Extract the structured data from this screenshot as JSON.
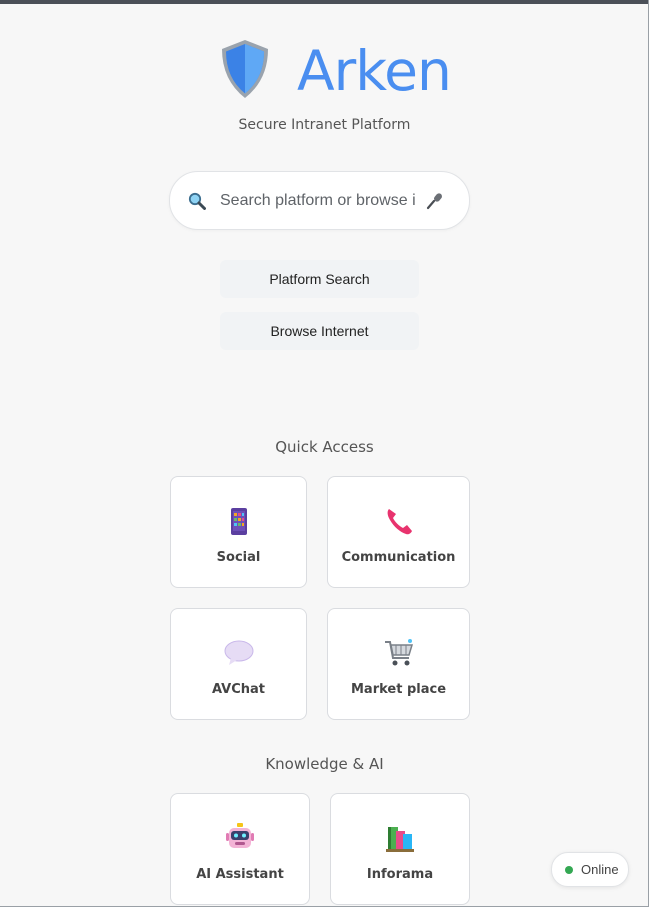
{
  "app": {
    "name": "Arken",
    "tagline": "Secure Intranet Platform",
    "brand_color": "#4a8ef0"
  },
  "search": {
    "placeholder": "Search platform or browse i",
    "search_icon": "magnifier-icon",
    "mic_icon": "microphone-icon"
  },
  "actions": {
    "platform_search": "Platform Search",
    "browse_internet": "Browse Internet"
  },
  "quick_access": {
    "title": "Quick Access",
    "items": [
      {
        "label": "Social",
        "icon": "phone-app-icon"
      },
      {
        "label": "Communication",
        "icon": "telephone-receiver-icon"
      },
      {
        "label": "AVChat",
        "icon": "speech-bubble-icon"
      },
      {
        "label": "Market place",
        "icon": "shopping-cart-icon"
      }
    ]
  },
  "knowledge": {
    "title": "Knowledge & AI",
    "items": [
      {
        "label": "AI Assistant",
        "icon": "robot-icon"
      },
      {
        "label": "Inforama",
        "icon": "books-icon"
      }
    ]
  },
  "status": {
    "label": "Online",
    "color": "#34a853"
  }
}
